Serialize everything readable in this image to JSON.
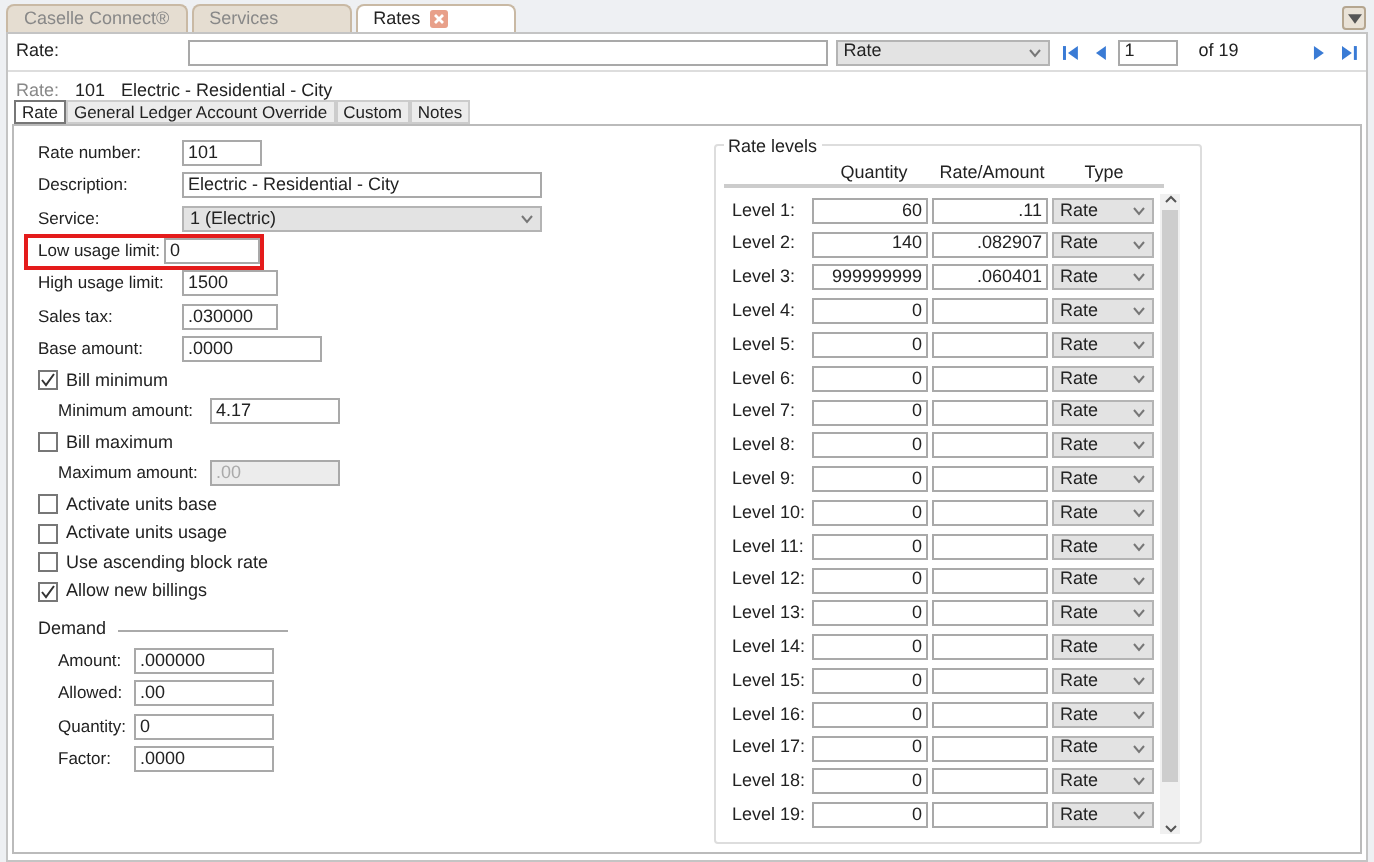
{
  "doc_tabs": [
    {
      "label": "Caselle Connect®",
      "selected": false,
      "closable": false
    },
    {
      "label": "Services",
      "selected": false,
      "closable": false
    },
    {
      "label": "Rates",
      "selected": true,
      "closable": true
    }
  ],
  "toolbar": {
    "search_label": "Rate:",
    "lookup_select": "Rate",
    "page": "1",
    "page_count": "of 19"
  },
  "record": {
    "label": "Rate:",
    "number": "101",
    "description": "Electric - Residential - City"
  },
  "tabs": [
    {
      "label": "Rate",
      "selected": true
    },
    {
      "label": "General Ledger Account Override",
      "selected": false
    },
    {
      "label": "Custom",
      "selected": false
    },
    {
      "label": "Notes",
      "selected": false
    }
  ],
  "fields": [
    {
      "kind": "text",
      "label": "Rate number:",
      "value": "101"
    },
    {
      "kind": "text",
      "label": "Description:",
      "value": "Electric - Residential - City"
    },
    {
      "kind": "select",
      "label": "Service:",
      "value": "1 (Electric)"
    },
    {
      "kind": "text",
      "label": "Low usage limit:",
      "value": "0",
      "highlighted": true
    },
    {
      "kind": "text",
      "label": "High usage limit:",
      "value": "1500"
    },
    {
      "kind": "text",
      "label": "Sales tax:",
      "value": ".030000"
    },
    {
      "kind": "text",
      "label": "Base amount:",
      "value": ".0000"
    },
    {
      "kind": "checkbox",
      "label": "Bill minimum",
      "checked": true,
      "children": [
        {
          "kind": "text",
          "label": "Minimum amount:",
          "value": "4.17",
          "disabled": false
        }
      ]
    },
    {
      "kind": "checkbox",
      "label": "Bill maximum",
      "checked": false,
      "children": [
        {
          "kind": "text",
          "label": "Maximum amount:",
          "value": ".00",
          "disabled": true
        }
      ]
    },
    {
      "kind": "checkbox",
      "label": "Activate units base",
      "checked": false
    },
    {
      "kind": "checkbox",
      "label": "Activate units usage",
      "checked": false
    },
    {
      "kind": "checkbox",
      "label": "Use ascending block rate",
      "checked": false
    },
    {
      "kind": "checkbox",
      "label": "Allow new billings",
      "checked": true
    }
  ],
  "demand": {
    "title": "Demand",
    "fields": [
      {
        "label": "Amount:",
        "value": ".000000"
      },
      {
        "label": "Allowed:",
        "value": ".00"
      },
      {
        "label": "Quantity:",
        "value": "0"
      },
      {
        "label": "Factor:",
        "value": ".0000"
      }
    ]
  },
  "rate_levels": {
    "title": "Rate levels",
    "columns": [
      "Quantity",
      "Rate/Amount",
      "Type"
    ],
    "rows": [
      {
        "label": "Level 1:",
        "quantity": "60",
        "rate": ".11",
        "type": "Rate"
      },
      {
        "label": "Level 2:",
        "quantity": "140",
        "rate": ".082907",
        "type": "Rate"
      },
      {
        "label": "Level 3:",
        "quantity": "999999999",
        "rate": ".060401",
        "type": "Rate"
      },
      {
        "label": "Level 4:",
        "quantity": "0",
        "rate": "",
        "type": "Rate"
      },
      {
        "label": "Level 5:",
        "quantity": "0",
        "rate": "",
        "type": "Rate"
      },
      {
        "label": "Level 6:",
        "quantity": "0",
        "rate": "",
        "type": "Rate"
      },
      {
        "label": "Level 7:",
        "quantity": "0",
        "rate": "",
        "type": "Rate"
      },
      {
        "label": "Level 8:",
        "quantity": "0",
        "rate": "",
        "type": "Rate"
      },
      {
        "label": "Level 9:",
        "quantity": "0",
        "rate": "",
        "type": "Rate"
      },
      {
        "label": "Level 10:",
        "quantity": "0",
        "rate": "",
        "type": "Rate"
      },
      {
        "label": "Level 11:",
        "quantity": "0",
        "rate": "",
        "type": "Rate"
      },
      {
        "label": "Level 12:",
        "quantity": "0",
        "rate": "",
        "type": "Rate"
      },
      {
        "label": "Level 13:",
        "quantity": "0",
        "rate": "",
        "type": "Rate"
      },
      {
        "label": "Level 14:",
        "quantity": "0",
        "rate": "",
        "type": "Rate"
      },
      {
        "label": "Level 15:",
        "quantity": "0",
        "rate": "",
        "type": "Rate"
      },
      {
        "label": "Level 16:",
        "quantity": "0",
        "rate": "",
        "type": "Rate"
      },
      {
        "label": "Level 17:",
        "quantity": "0",
        "rate": "",
        "type": "Rate"
      },
      {
        "label": "Level 18:",
        "quantity": "0",
        "rate": "",
        "type": "Rate"
      },
      {
        "label": "Level 19:",
        "quantity": "0",
        "rate": "",
        "type": "Rate"
      }
    ]
  }
}
